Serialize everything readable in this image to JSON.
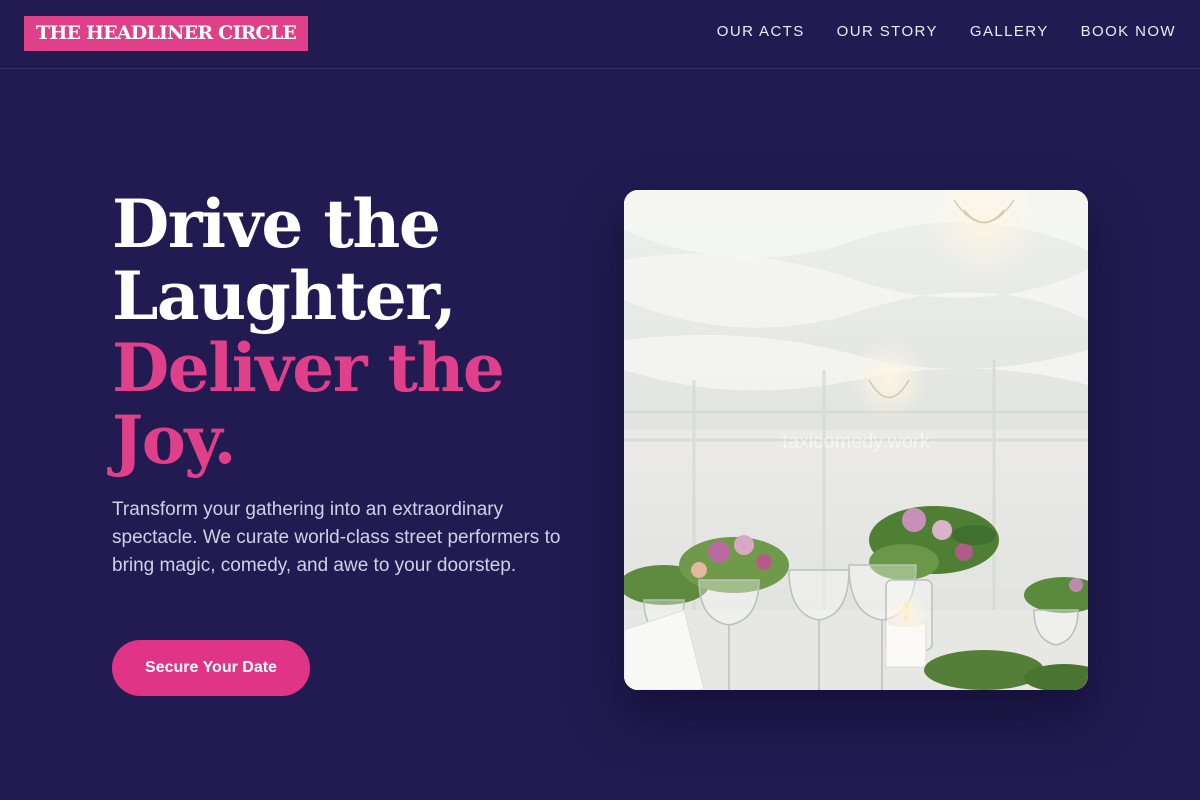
{
  "brand": {
    "name": "THE HEADLINER CIRCLE",
    "accent_color": "#e0408a",
    "background": "#211b51"
  },
  "nav": {
    "items": [
      {
        "label": "OUR ACTS"
      },
      {
        "label": "OUR STORY"
      },
      {
        "label": "GALLERY"
      },
      {
        "label": "BOOK NOW"
      }
    ]
  },
  "hero": {
    "headline_lines": [
      "Drive the",
      "Laughter,"
    ],
    "headline_accent_lines": [
      "Deliver the",
      "Joy."
    ],
    "subtext": "Transform your gathering into an extraordinary spectacle. We curate world-class street performers to bring magic, comedy, and awe to your doorstep.",
    "cta_label": "Secure Your Date",
    "image": {
      "description_icon": "event-table-photo",
      "watermark": "taxicomedy.work"
    }
  }
}
